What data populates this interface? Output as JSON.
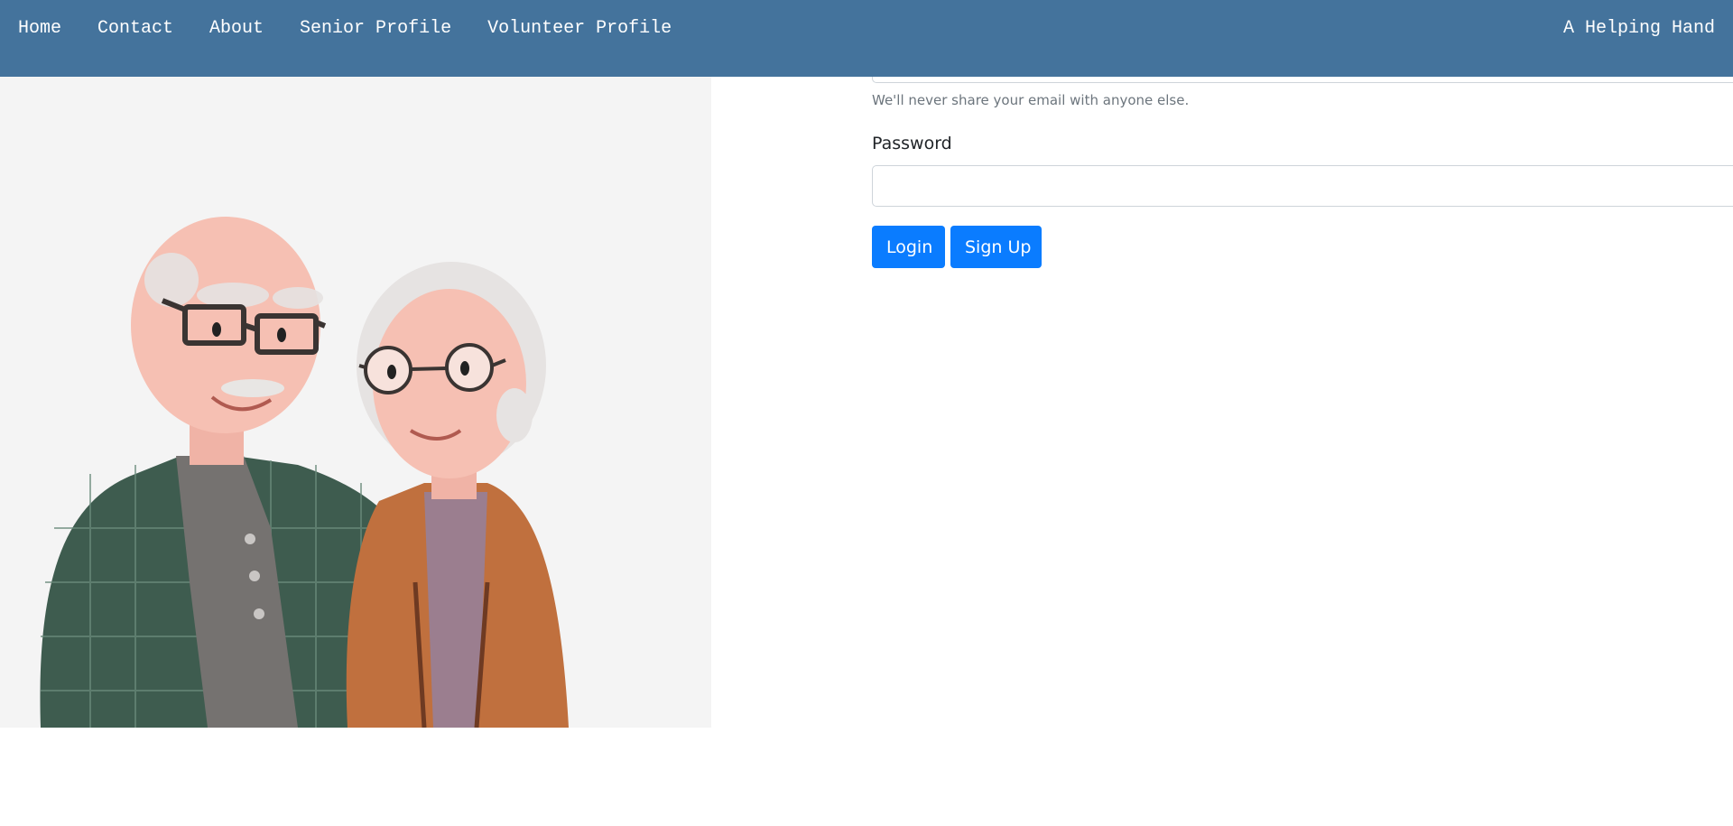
{
  "nav": {
    "links": [
      "Home",
      "Contact",
      "About",
      "Senior Profile",
      "Volunteer Profile"
    ],
    "brand": "A Helping Hand"
  },
  "form": {
    "email_help": "We'll never share your email with anyone else.",
    "email_value": "",
    "password_label": "Password",
    "password_value": "",
    "login_label": "Login",
    "signup_label": "Sign Up"
  },
  "illustration": {
    "alt": "elderly-couple-illustration"
  },
  "colors": {
    "navbar": "#44739c",
    "button": "#0a7cff",
    "illustration_bg": "#f4f4f4"
  }
}
